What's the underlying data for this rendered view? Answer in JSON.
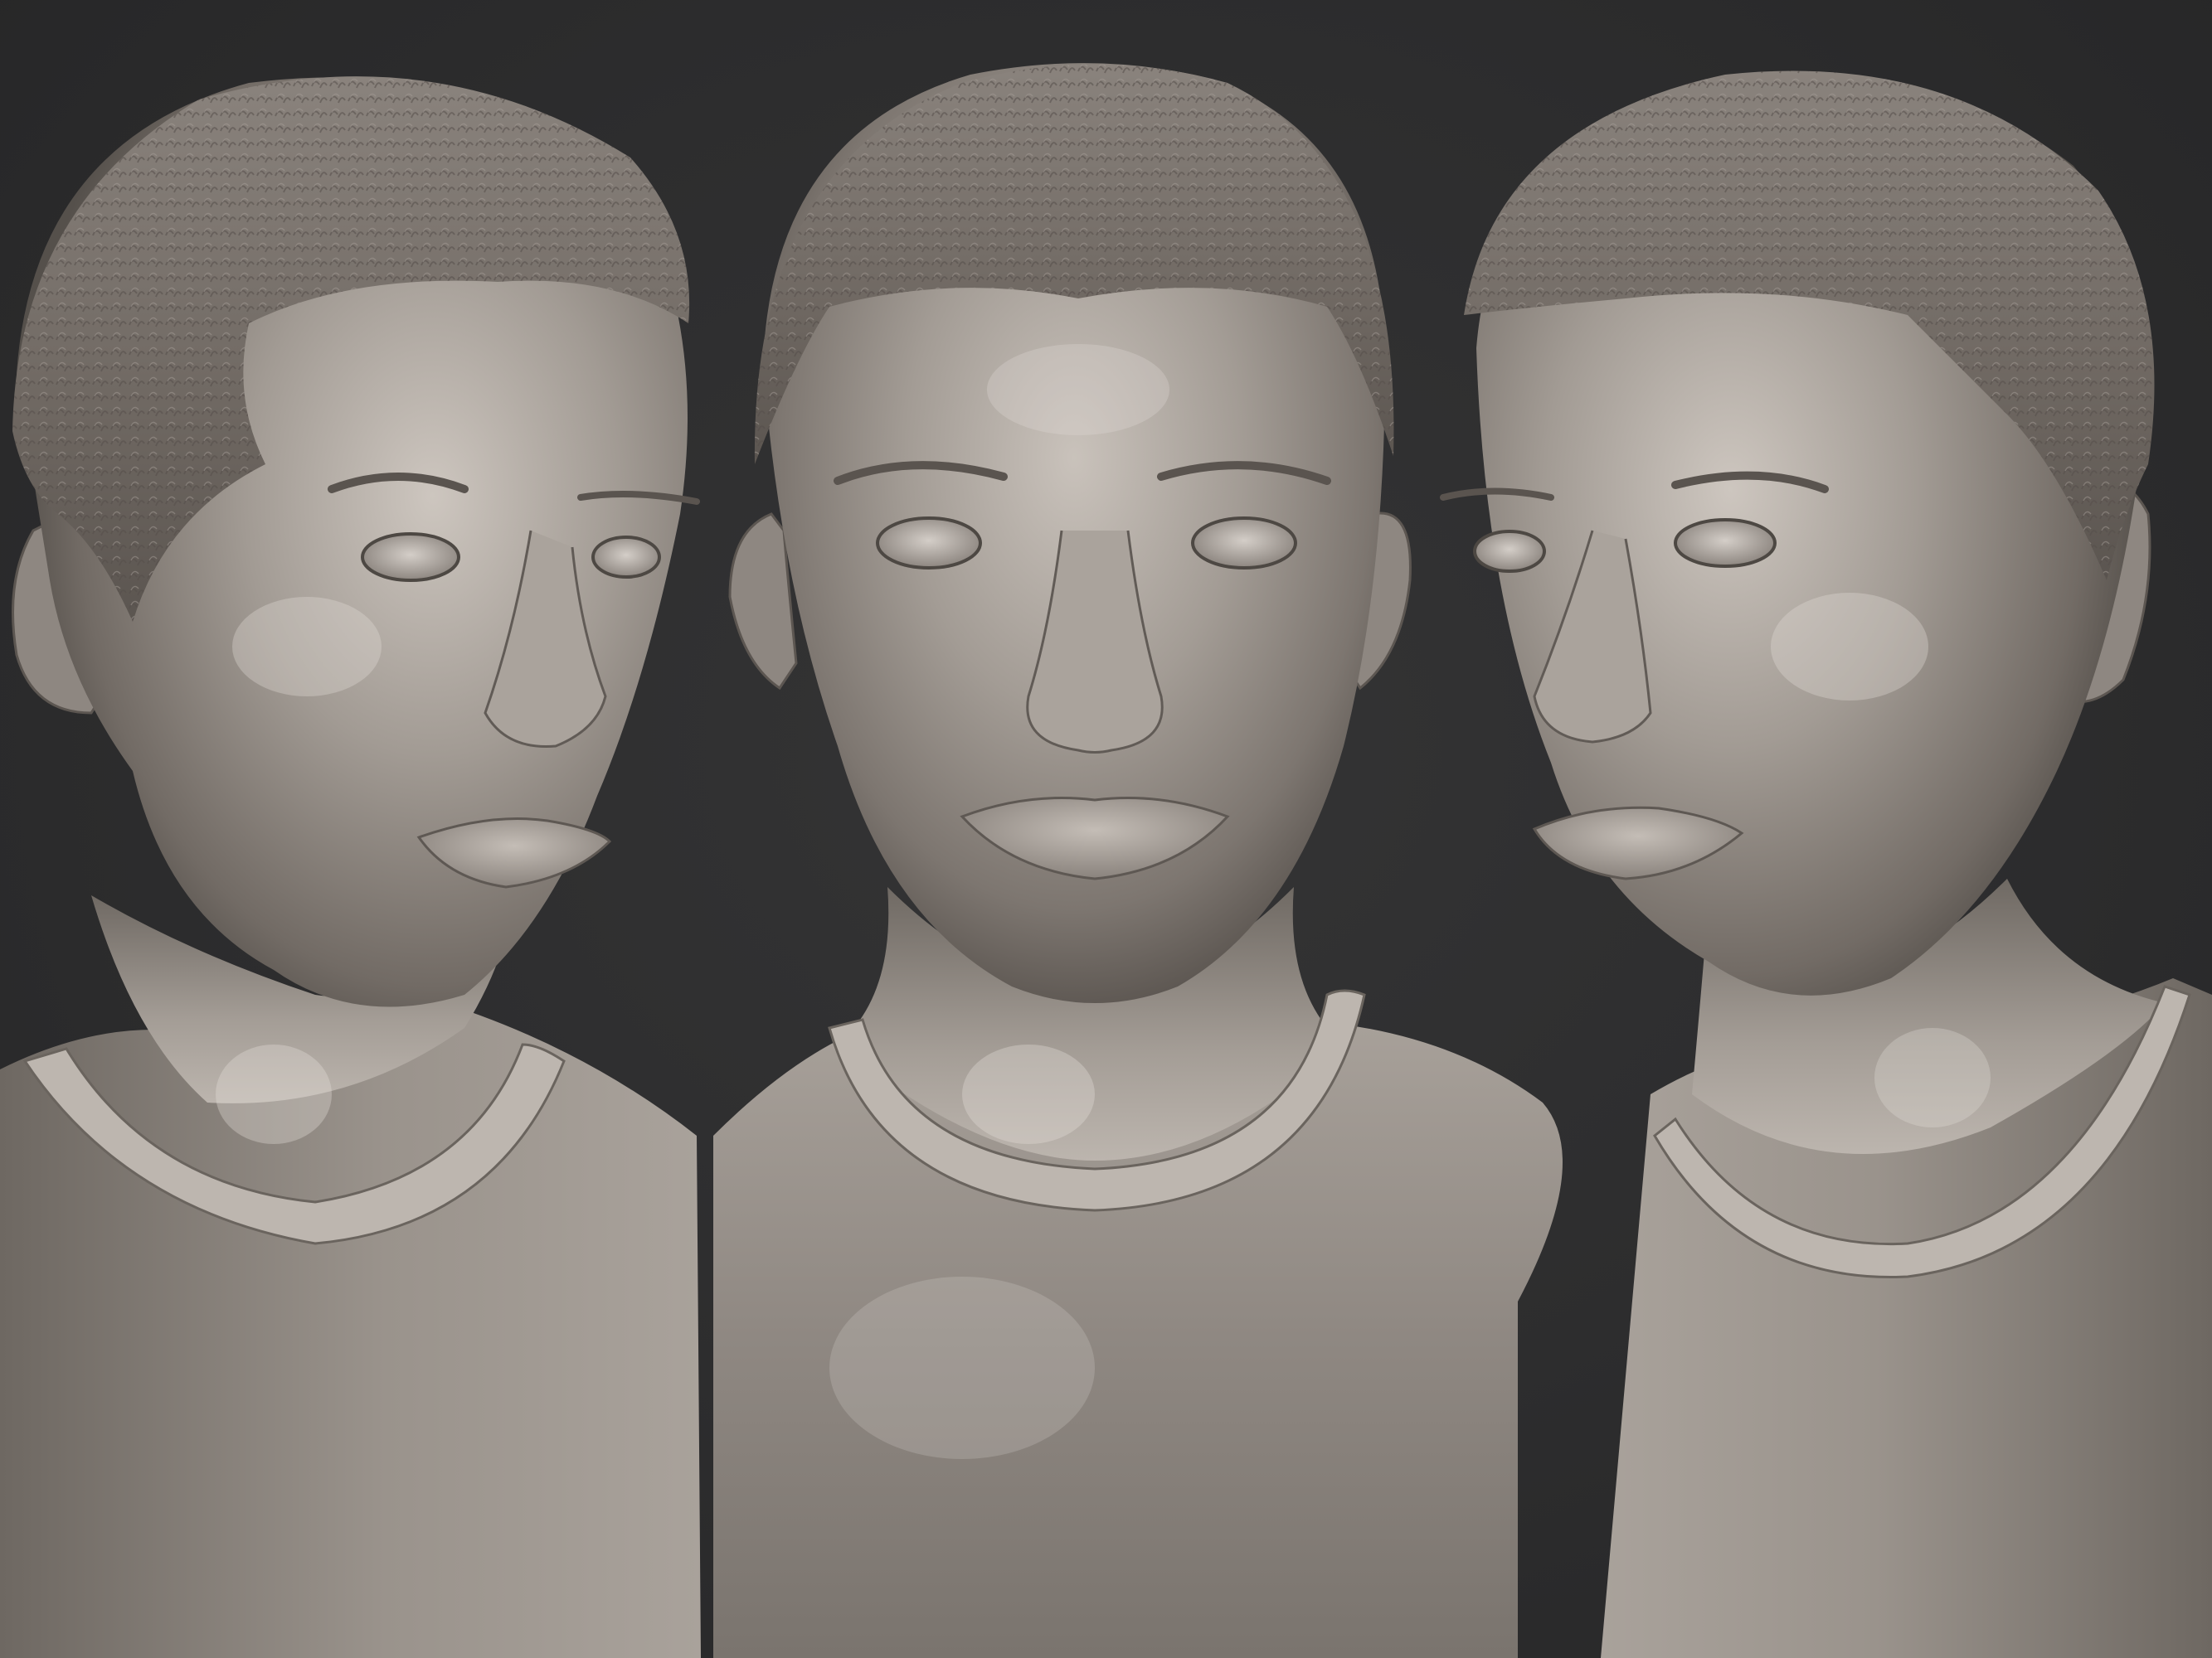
{
  "scene": {
    "subject": "sculpt-render",
    "background_color": "#2c2c2d",
    "material_color": "#9c958f",
    "highlight_color": "#d9d4ce",
    "shadow_color": "#4a4541",
    "views": [
      {
        "id": "left-three-quarter"
      },
      {
        "id": "front"
      },
      {
        "id": "right-three-quarter"
      }
    ]
  }
}
